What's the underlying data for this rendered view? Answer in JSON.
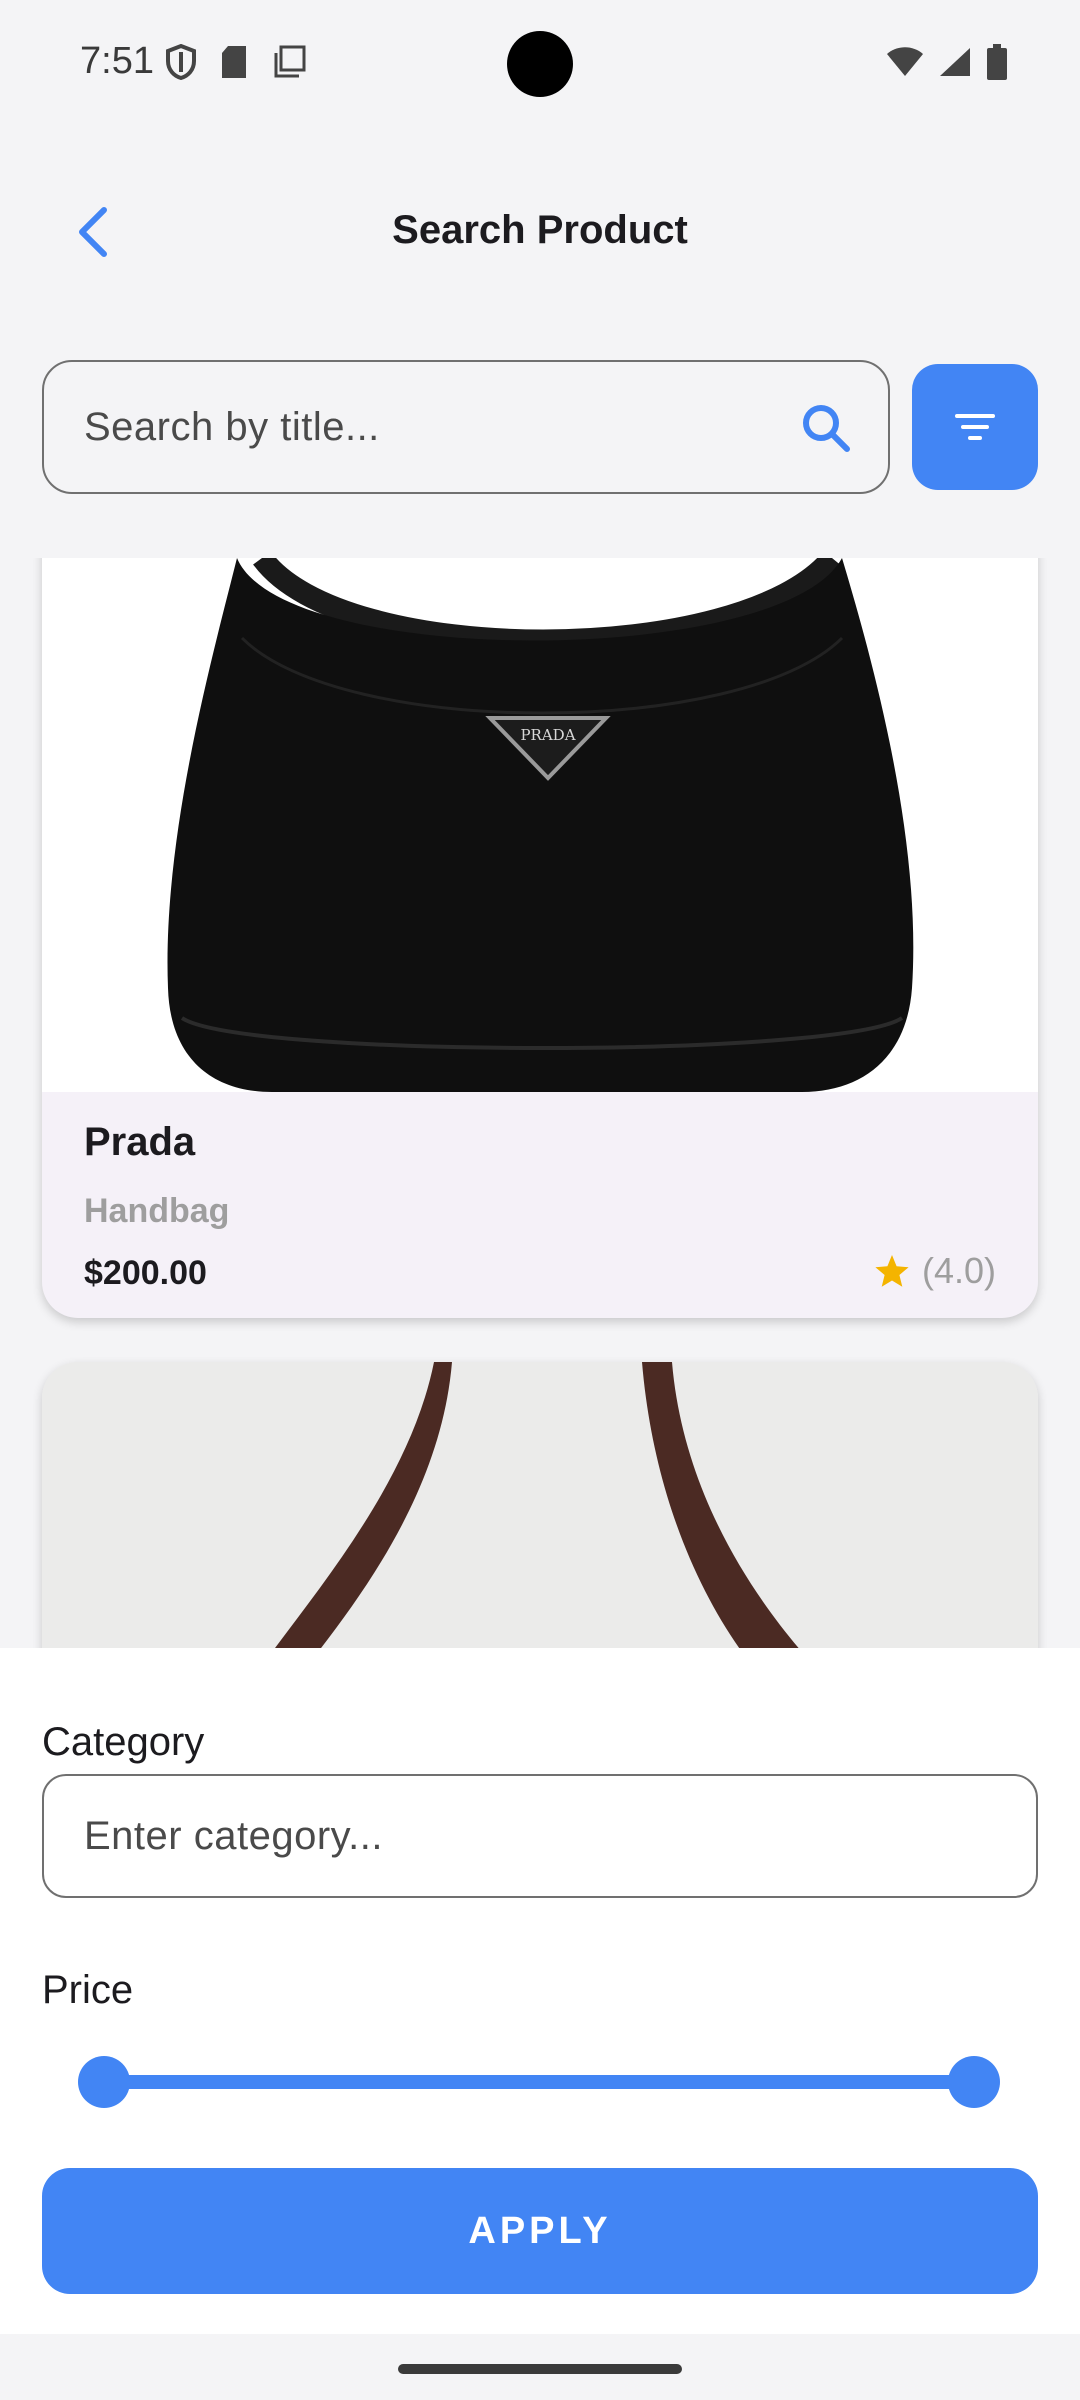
{
  "status_bar": {
    "time": "7:51",
    "left_icons": [
      "shield-icon",
      "sd-card-icon",
      "copy-icon"
    ],
    "right_icons": [
      "wifi-icon",
      "signal-icon",
      "battery-icon"
    ]
  },
  "header": {
    "title": "Search Product",
    "back_icon": "chevron-left-icon"
  },
  "search": {
    "placeholder": "Search by title...",
    "value": "",
    "search_icon": "search-icon",
    "filter_icon": "filter-icon"
  },
  "products": [
    {
      "title": "Prada",
      "category": "Handbag",
      "price": "$200.00",
      "rating": "(4.0)",
      "image_brand": "PRADA"
    },
    {
      "title": "",
      "category": "",
      "price": "",
      "rating": ""
    }
  ],
  "filter_sheet": {
    "category_label": "Category",
    "category_placeholder": "Enter category...",
    "category_value": "",
    "price_label": "Price",
    "price_range_selected": {
      "min_fraction": 0.0,
      "max_fraction": 1.0
    },
    "apply_label": "APPLY"
  },
  "colors": {
    "accent": "#4285f4",
    "background": "#f4f4f6",
    "card": "#f5f1f8",
    "star": "#f4b400",
    "muted_text": "#9e9e9e"
  }
}
